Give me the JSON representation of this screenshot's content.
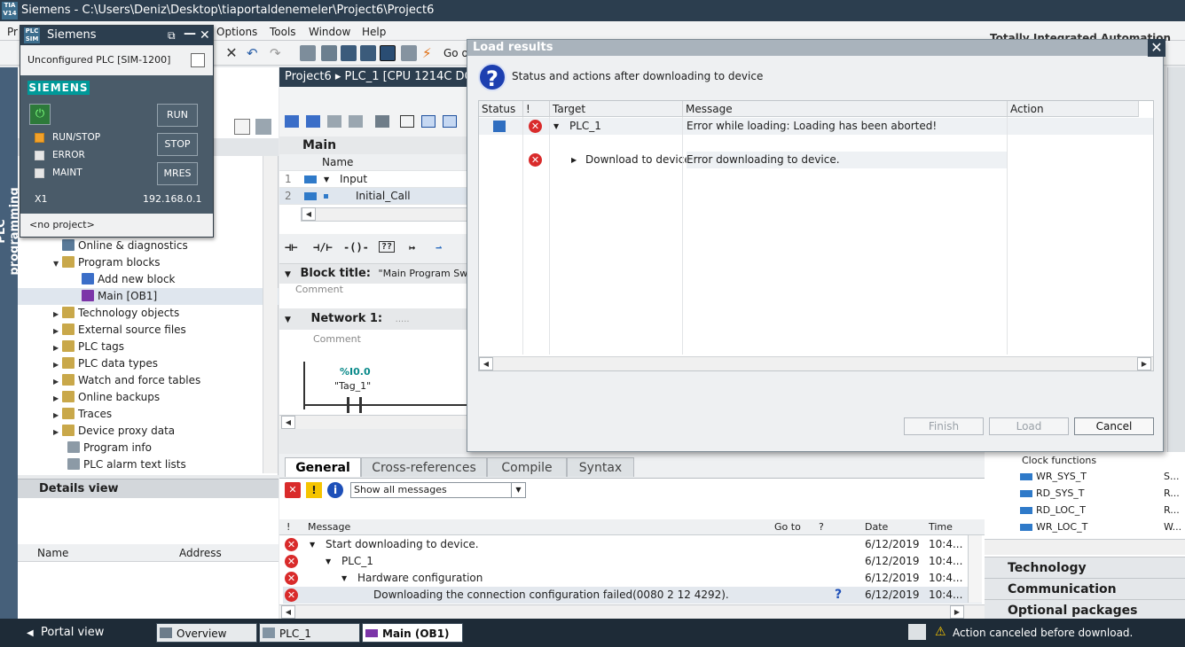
{
  "window": {
    "title": "Siemens  -  C:\\Users\\Deniz\\Desktop\\tiaportaldenemeler\\Project6\\Project6",
    "tia_badge": "TIA V14"
  },
  "menu": {
    "items": [
      "Pr",
      "Options",
      "Tools",
      "Window",
      "Help"
    ],
    "go_online_partial": "Go o"
  },
  "brand_partial": "Totally Integrated Automation",
  "left_tab": "PLC programming",
  "simulator": {
    "title": "Siemens",
    "badge": "PLC SIM",
    "subtitle": "Unconfigured PLC [SIM-1200]",
    "logo": "SIEMENS",
    "run": "RUN",
    "stop": "STOP",
    "mres": "MRES",
    "leds": [
      "RUN/STOP",
      "ERROR",
      "MAINT"
    ],
    "port": "X1",
    "ip": "192.168.0.1",
    "project": "<no project>"
  },
  "tree": {
    "items": [
      {
        "label": "Online & diagnostics"
      },
      {
        "label": "Program blocks"
      },
      {
        "label": "Add new block"
      },
      {
        "label": "Main [OB1]"
      },
      {
        "label": "Technology objects"
      },
      {
        "label": "External source files"
      },
      {
        "label": "PLC tags"
      },
      {
        "label": "PLC data types"
      },
      {
        "label": "Watch and force tables"
      },
      {
        "label": "Online backups"
      },
      {
        "label": "Traces"
      },
      {
        "label": "Device proxy data"
      },
      {
        "label": "Program info"
      },
      {
        "label": "PLC alarm text lists"
      }
    ]
  },
  "details": {
    "title": "Details view",
    "col_name": "Name",
    "col_address": "Address"
  },
  "editor": {
    "breadcrumb": "Project6  ▸  PLC_1 [CPU 1214C DC",
    "interface_title": "Main",
    "col_name": "Name",
    "rows": [
      {
        "num": "1",
        "name": "Input"
      },
      {
        "num": "2",
        "name": "Initial_Call"
      }
    ],
    "block_title_label": "Block title:",
    "block_title_value": "\"Main Program Swe",
    "comment": "Comment",
    "network_label": "Network 1:",
    "network_dots": ".....",
    "contact_address": "%I0.0",
    "contact_tag": "\"Tag_1\""
  },
  "inspector": {
    "tabs": [
      "General",
      "Cross-references",
      "Compile",
      "Syntax"
    ],
    "filter": "Show all messages",
    "columns": {
      "excl": "!",
      "message": "Message",
      "goto": "Go to",
      "q": "?",
      "date": "Date",
      "time": "Time"
    },
    "rows": [
      {
        "message": "Start downloading to device.",
        "date": "6/12/2019",
        "time": "10:4..."
      },
      {
        "message": "PLC_1",
        "date": "6/12/2019",
        "time": "10:4..."
      },
      {
        "message": "Hardware configuration",
        "date": "6/12/2019",
        "time": "10:4..."
      },
      {
        "message": "Downloading the connection configuration failed(0080 2 12 4292).",
        "date": "6/12/2019",
        "time": "10:4..."
      }
    ]
  },
  "right_panel": {
    "clock_header": "Clock functions",
    "items": [
      {
        "name": "WR_SYS_T",
        "desc": "S..."
      },
      {
        "name": "RD_SYS_T",
        "desc": "R..."
      },
      {
        "name": "RD_LOC_T",
        "desc": "R..."
      },
      {
        "name": "WR_LOC_T",
        "desc": "W..."
      }
    ],
    "sections": [
      "Technology",
      "Communication",
      "Optional packages"
    ]
  },
  "statusbar": {
    "portal": "Portal view",
    "tabs": [
      "Overview",
      "PLC_1",
      "Main (OB1)"
    ],
    "message": "Action canceled before download."
  },
  "dialog": {
    "title": "Load results",
    "heading": "Status and actions after downloading to device",
    "columns": {
      "status": "Status",
      "excl": "!",
      "target": "Target",
      "message": "Message",
      "action": "Action"
    },
    "rows": [
      {
        "target": "PLC_1",
        "message": "Error while loading: Loading has been aborted!"
      },
      {
        "target": "Download to device",
        "message": "Error downloading to device."
      }
    ],
    "buttons": {
      "finish": "Finish",
      "load": "Load",
      "cancel": "Cancel"
    }
  },
  "colors": {
    "accent_dark": "#2c3e4f",
    "error": "#d92b2b",
    "siemens_teal": "#009999"
  }
}
